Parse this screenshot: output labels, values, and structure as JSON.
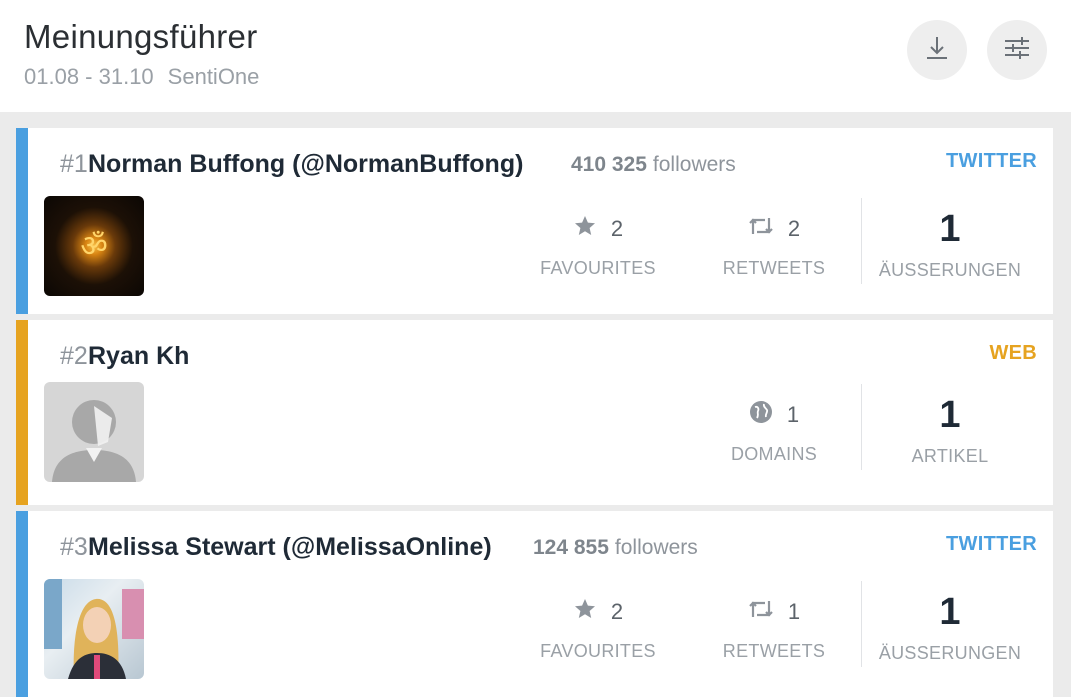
{
  "header": {
    "title": "Meinungsführer",
    "date_range": "01.08 - 31.10",
    "source": "SentiOne"
  },
  "colors": {
    "twitter": "#4a9fe0",
    "web": "#e6a320"
  },
  "cards": [
    {
      "rank": "#1",
      "name": "Norman Buffong (@NormanBuffong)",
      "followers_count": "410 325",
      "followers_label": "followers",
      "source": "TWITTER",
      "favourites": "2",
      "favourites_label": "FAVOURITES",
      "retweets": "2",
      "retweets_label": "RETWEETS",
      "total": "1",
      "total_label": "ÄUSSERUNGEN"
    },
    {
      "rank": "#2",
      "name": "Ryan Kh",
      "source": "WEB",
      "domains": "1",
      "domains_label": "DOMAINS",
      "total": "1",
      "total_label": "ARTIKEL"
    },
    {
      "rank": "#3",
      "name": "Melissa Stewart (@MelissaOnline)",
      "followers_count": "124 855",
      "followers_label": "followers",
      "source": "TWITTER",
      "favourites": "2",
      "favourites_label": "FAVOURITES",
      "retweets": "1",
      "retweets_label": "RETWEETS",
      "total": "1",
      "total_label": "ÄUSSERUNGEN"
    }
  ]
}
